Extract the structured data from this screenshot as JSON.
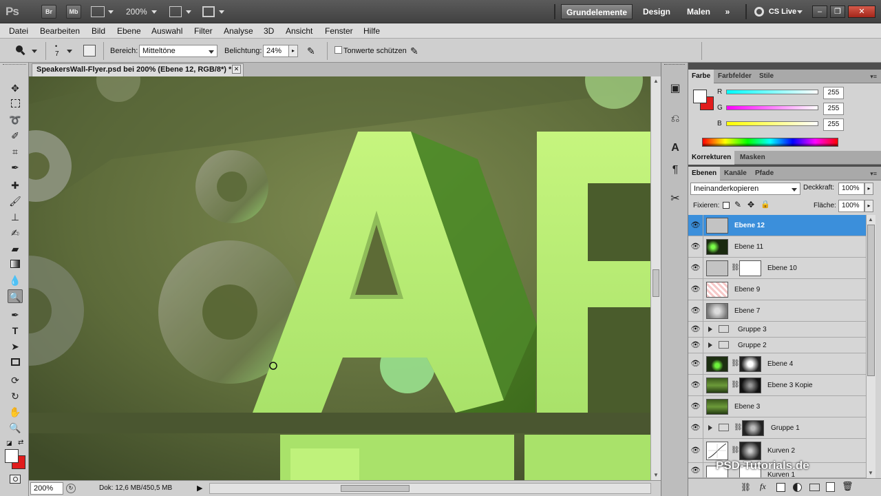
{
  "app": {
    "logo": "Ps",
    "bridge_btn": "Br",
    "minibridge_btn": "Mb",
    "zoom_select": "200%",
    "workspaces": [
      "Grundelemente",
      "Design",
      "Malen"
    ],
    "cslive": "CS Live",
    "win_controls": [
      "–",
      "❐",
      "✕"
    ]
  },
  "menu": [
    "Datei",
    "Bearbeiten",
    "Bild",
    "Ebene",
    "Auswahl",
    "Filter",
    "Analyse",
    "3D",
    "Ansicht",
    "Fenster",
    "Hilfe"
  ],
  "options": {
    "brush_size": "7",
    "range_label": "Bereich:",
    "range_value": "Mitteltöne",
    "exposure_label": "Belichtung:",
    "exposure_value": "24%",
    "protect_tones_label": "Tonwerte schützen"
  },
  "document": {
    "tab_title": "SpeakersWall-Flyer.psd bei 200% (Ebene 12, RGB/8*) *",
    "close": "✕",
    "status_zoom": "200%",
    "status_doc": "Dok: 12,6 MB/450,5 MB"
  },
  "color_panel": {
    "tabs": [
      "Farbe",
      "Farbfelder",
      "Stile"
    ],
    "channels": [
      {
        "label": "R",
        "value": "255"
      },
      {
        "label": "G",
        "value": "255"
      },
      {
        "label": "B",
        "value": "255"
      }
    ],
    "fg_color": "#ffffff",
    "bg_color": "#e11c1c"
  },
  "corrections_panel": {
    "tabs": [
      "Korrekturen",
      "Masken"
    ]
  },
  "layers_panel": {
    "tabs": [
      "Ebenen",
      "Kanäle",
      "Pfade"
    ],
    "blend_mode": "Ineinanderkopieren",
    "opacity_label": "Deckkraft:",
    "opacity_value": "100%",
    "lock_label": "Fixieren:",
    "fill_label": "Fläche:",
    "fill_value": "100%",
    "layers": [
      {
        "name": "Ebene 12",
        "selected": true
      },
      {
        "name": "Ebene 11"
      },
      {
        "name": "Ebene 10"
      },
      {
        "name": "Ebene 9"
      },
      {
        "name": "Ebene 7"
      },
      {
        "name": "Gruppe 3"
      },
      {
        "name": "Gruppe 2"
      },
      {
        "name": "Ebene 4"
      },
      {
        "name": "Ebene 3 Kopie"
      },
      {
        "name": "Ebene 3"
      },
      {
        "name": "Gruppe 1"
      },
      {
        "name": "Kurven 2"
      },
      {
        "name": "Kurven 1"
      }
    ]
  },
  "watermark": "PSD-Tutorials.de"
}
